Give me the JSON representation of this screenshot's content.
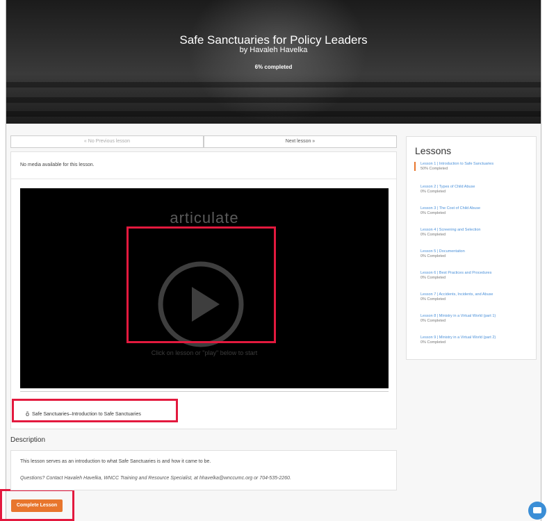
{
  "course": {
    "title": "Safe Sanctuaries for Policy Leaders",
    "author": "by Havaleh Havelka",
    "progress": "6% completed"
  },
  "navigation": {
    "previous_label": "« No Previous lesson",
    "next_label": "Next lesson »"
  },
  "content": {
    "no_media_text": "No media available for this lesson.",
    "player": {
      "logo_text": "articulate",
      "hint_text": "Click on lesson or \"play\" below to start"
    },
    "file_link_label": "Safe Sanctuaries–Introduction to Safe Sanctuaries"
  },
  "description": {
    "heading": "Description",
    "text": "This lesson serves as an introduction to what Safe Sanctuaries is and how it came to be.",
    "contact": "Questions? Contact Havaleh Havelka, WNCC Training and Resource Specialist, at hhavelka@wnccumc.org or 704-535-2260."
  },
  "complete_button_label": "Complete Lesson",
  "sidebar": {
    "title": "Lessons",
    "lessons": [
      {
        "name": "Lesson 1 | Introduction to Safe Sanctuaries",
        "status": "50% Completed"
      },
      {
        "name": "Lesson 2 | Types of Child Abuse",
        "status": "0% Completed"
      },
      {
        "name": "Lesson 3 | The Cost of Child Abuse",
        "status": "0% Completed"
      },
      {
        "name": "Lesson 4 | Screening and Selection",
        "status": "0% Completed"
      },
      {
        "name": "Lesson 5 | Documentation",
        "status": "0% Completed"
      },
      {
        "name": "Lesson 6 | Best Practices and Procedures",
        "status": "0% Completed"
      },
      {
        "name": "Lesson 7 | Accidents, Incidents, and Abuse",
        "status": "0% Completed"
      },
      {
        "name": "Lesson 8 | Ministry in a Virtual World (part 1)",
        "status": "0% Completed"
      },
      {
        "name": "Lesson 9 | Ministry in a Virtual World (part 2)",
        "status": "0% Completed"
      }
    ]
  },
  "colors": {
    "accent": "#e8762d",
    "highlight": "#e3193e",
    "link": "#4a90d9"
  }
}
